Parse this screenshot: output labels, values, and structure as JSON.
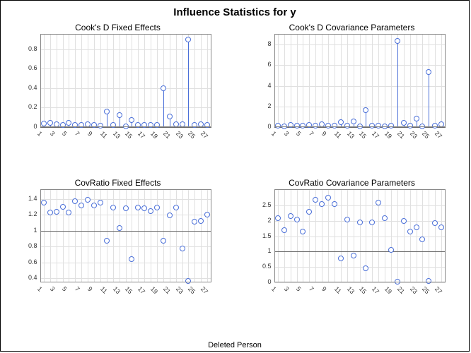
{
  "title": "Influence Statistics for y",
  "x_axis_label": "Deleted Person",
  "chart_data": [
    {
      "type": "stem",
      "title": "Cook's D Fixed Effects",
      "x": [
        1,
        2,
        3,
        4,
        5,
        6,
        7,
        8,
        9,
        10,
        11,
        12,
        13,
        14,
        15,
        16,
        17,
        18,
        19,
        20,
        21,
        22,
        23,
        24,
        25,
        26,
        27
      ],
      "values": [
        0.035,
        0.045,
        0.03,
        0.02,
        0.045,
        0.02,
        0.02,
        0.03,
        0.02,
        0.017,
        0.16,
        0.02,
        0.12,
        0.01,
        0.07,
        0.02,
        0.025,
        0.02,
        0.02,
        0.4,
        0.11,
        0.03,
        0.03,
        0.9,
        0.02,
        0.03,
        0.02
      ],
      "ylim": [
        0,
        0.9
      ],
      "yticks": [
        0.0,
        0.2,
        0.4,
        0.6,
        0.8
      ],
      "ref": 0
    },
    {
      "type": "stem",
      "title": "Cook's D Covariance Parameters",
      "x": [
        1,
        2,
        3,
        4,
        5,
        6,
        7,
        8,
        9,
        10,
        11,
        12,
        13,
        14,
        15,
        16,
        17,
        18,
        19,
        20,
        21,
        22,
        23,
        24,
        25,
        26,
        27
      ],
      "values": [
        0.15,
        0.1,
        0.2,
        0.12,
        0.12,
        0.2,
        0.15,
        0.28,
        0.15,
        0.12,
        0.5,
        0.12,
        0.55,
        0.1,
        1.65,
        0.12,
        0.15,
        0.1,
        0.12,
        8.35,
        0.38,
        0.12,
        0.85,
        0.1,
        5.35,
        0.15,
        0.25
      ],
      "ylim": [
        0,
        8.5
      ],
      "yticks": [
        0,
        2,
        4,
        6,
        8
      ],
      "ref": 0
    },
    {
      "type": "scatter",
      "title": "CovRatio Fixed Effects",
      "x": [
        1,
        2,
        3,
        4,
        5,
        6,
        7,
        8,
        9,
        10,
        11,
        12,
        13,
        14,
        15,
        16,
        17,
        18,
        19,
        20,
        21,
        22,
        23,
        24,
        25,
        26,
        27
      ],
      "values": [
        1.35,
        1.23,
        1.24,
        1.3,
        1.23,
        1.37,
        1.32,
        1.39,
        1.32,
        1.35,
        0.87,
        1.29,
        1.03,
        1.28,
        0.64,
        1.29,
        1.28,
        1.25,
        1.29,
        0.87,
        1.19,
        1.29,
        0.78,
        0.37,
        1.11,
        1.12,
        1.2
      ],
      "ylim": [
        0.35,
        1.45
      ],
      "yticks": [
        0.4,
        0.6,
        0.8,
        1.0,
        1.2,
        1.4
      ],
      "ref": 1
    },
    {
      "type": "scatter",
      "title": "CovRatio Covariance Parameters",
      "x": [
        1,
        2,
        3,
        4,
        5,
        6,
        7,
        8,
        9,
        10,
        11,
        12,
        13,
        14,
        15,
        16,
        17,
        18,
        19,
        20,
        21,
        22,
        23,
        24,
        25,
        26,
        27
      ],
      "values": [
        2.1,
        1.7,
        2.15,
        2.05,
        1.65,
        2.3,
        2.7,
        2.55,
        2.75,
        2.55,
        0.78,
        2.05,
        0.88,
        1.95,
        0.45,
        1.95,
        2.6,
        2.1,
        1.05,
        0.03,
        2.0,
        1.65,
        1.8,
        1.4,
        0.05,
        1.93,
        1.8
      ],
      "ylim": [
        0,
        2.85
      ],
      "yticks": [
        0.0,
        0.5,
        1.0,
        1.5,
        2.0,
        2.5
      ],
      "ref": 1
    }
  ]
}
